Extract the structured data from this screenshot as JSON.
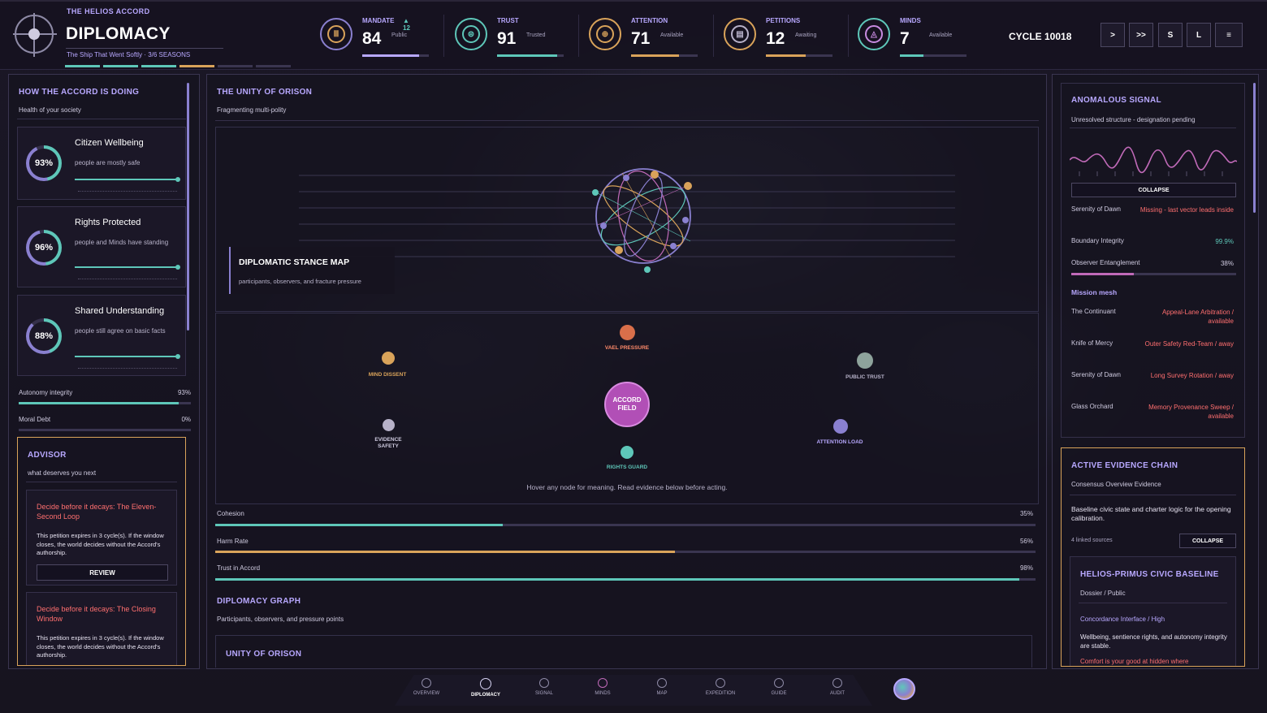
{
  "header": {
    "accord": "THE HELIOS ACCORD",
    "title": "DIPLOMACY",
    "subtitle": "The Ship That Went Softly · 3/6 SEASONS",
    "cycle": "CYCLE 10018"
  },
  "stats": [
    {
      "label": "MANDATE",
      "delta": "▲ 12",
      "value": "84",
      "sub": "Public",
      "level": 0.85,
      "color": "#b8a8ff"
    },
    {
      "label": "TRUST",
      "value": "91",
      "sub": "Trusted",
      "level": 0.9,
      "color": "#5ec7b9"
    },
    {
      "label": "ATTENTION",
      "value": "71",
      "sub": "Available",
      "level": 0.72,
      "color": "#d9a35a"
    },
    {
      "label": "PETITIONS",
      "value": "12",
      "sub": "Awaiting",
      "level": 0.6,
      "color": "#d9a35a"
    },
    {
      "label": "MINDS",
      "value": "7",
      "sub": "Available",
      "level": 0.35,
      "color": "#5ec7b9"
    }
  ],
  "toolbar": {
    "step": ">",
    "fast": ">>",
    "save": "S",
    "load": "L",
    "menu": "≡"
  },
  "left": {
    "title": "HOW THE ACCORD IS DOING",
    "subtitle": "Health of your society",
    "metrics": [
      {
        "pct": "93%",
        "value": 93,
        "title": "Citizen Wellbeing",
        "desc": "people are mostly safe"
      },
      {
        "pct": "96%",
        "value": 96,
        "title": "Rights Protected",
        "desc": "people and Minds have standing"
      },
      {
        "pct": "88%",
        "value": 88,
        "title": "Shared Understanding",
        "desc": "people still agree on basic facts"
      }
    ],
    "autonomy_label": "Autonomy integrity",
    "autonomy_value": "93%",
    "debt_label": "Moral Debt",
    "debt_value": "0%",
    "advisor": {
      "title": "ADVISOR",
      "subtitle": "what deserves you next",
      "cards": [
        {
          "title": "Decide before it decays: The Eleven-Second Loop",
          "desc": "This petition expires in 3 cycle(s). If the window closes, the world decides without the Accord's authorship.",
          "button": "REVIEW"
        },
        {
          "title": "Decide before it decays: The Closing Window",
          "desc": "This petition expires in 3 cycle(s). If the window closes, the world decides without the Accord's authorship."
        }
      ]
    }
  },
  "center": {
    "title": "THE UNITY OF ORISON",
    "subtitle": "Fragmenting multi-polity",
    "stance_title": "DIPLOMATIC STANCE MAP",
    "stance_sub": "participants, observers, and fracture pressure",
    "nodes": {
      "vael": "VAEL PRESSURE",
      "mind": "MIND DISSENT",
      "public": "PUBLIC TRUST",
      "accord": "ACCORD FIELD",
      "evidence": "EVIDENCE SAFETY",
      "attention": "ATTENTION LOAD",
      "rights": "RIGHTS GUARD"
    },
    "hint": "Hover any node for meaning. Read evidence below before acting.",
    "bars": [
      {
        "label": "Cohesion",
        "value": "35%",
        "fraction": 0.35,
        "color": "#5ec7b9"
      },
      {
        "label": "Harm Rate",
        "value": "56%",
        "fraction": 0.56,
        "color": "#d9a35a"
      },
      {
        "label": "Trust in Accord",
        "value": "98%",
        "fraction": 0.98,
        "color": "#5ec7b9"
      }
    ],
    "graph_title": "DIPLOMACY GRAPH",
    "graph_sub": "Participants, observers, and pressure points",
    "unity_title": "UNITY OF ORISON"
  },
  "right": {
    "signal_title": "ANOMALOUS SIGNAL",
    "signal_sub": "Unresolved structure - designation pending",
    "collapse": "COLLAPSE",
    "rows": [
      {
        "k": "Serenity of Dawn",
        "v": "Missing - last vector leads inside"
      },
      {
        "k": "Boundary Integrity",
        "v": "99.9%"
      },
      {
        "k": "Observer Entanglement",
        "v": "38%"
      }
    ],
    "observer_fraction": 0.38,
    "mesh_title": "Mission mesh",
    "mesh": [
      {
        "k": "The Continuant",
        "v": "Appeal-Lane Arbitration / available"
      },
      {
        "k": "Knife of Mercy",
        "v": "Outer Safety Red-Team / away"
      },
      {
        "k": "Serenity of Dawn",
        "v": "Long Survey Rotation / away"
      },
      {
        "k": "Glass Orchard",
        "v": "Memory Provenance Sweep / available"
      }
    ],
    "evidence_title": "ACTIVE EVIDENCE CHAIN",
    "evidence_sub": "Consensus Overview Evidence",
    "evidence_desc": "Baseline civic state and charter logic for the opening calibration.",
    "linked": "4 linked sources",
    "baseline_title": "HELIOS-PRIMUS CIVIC BASELINE",
    "baseline_sub": "Dossier / Public",
    "baseline_iface": "Concordance Interface / High",
    "baseline_desc": "Wellbeing, sentience rights, and autonomy integrity are stable.",
    "baseline_cut": "Comfort is your good at hidden where"
  },
  "nav": [
    "OVERVIEW",
    "DIPLOMACY",
    "SIGNAL",
    "MINDS",
    "MAP",
    "EXPEDITION",
    "GUIDE",
    "AUDIT"
  ],
  "colors": {
    "accent": "#b8a8ff",
    "teal": "#5ec7b9",
    "amber": "#d9a35a",
    "alert": "#ff6f6f"
  }
}
